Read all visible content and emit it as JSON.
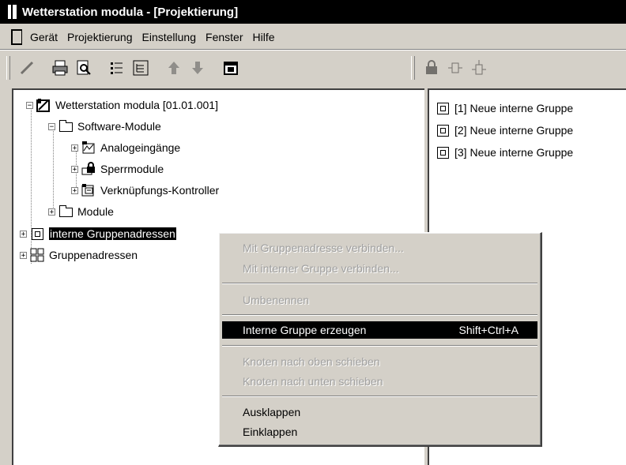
{
  "window": {
    "title": "Wetterstation modula  - [Projektierung]"
  },
  "menu": [
    "Gerät",
    "Projektierung",
    "Einstellung",
    "Fenster",
    "Hilfe"
  ],
  "tree": {
    "root": "Wetterstation modula [01.01.001]",
    "software_modules": "Software-Module",
    "analog_inputs": "Analogeingänge",
    "lock_modules": "Sperrmodule",
    "logic_controller": "Verknüpfungs-Kontroller",
    "modules": "Module",
    "internal_group_addresses": "interne Gruppenadressen",
    "group_addresses": "Gruppenadressen"
  },
  "right_list": [
    "[1] Neue interne Gruppe",
    "[2] Neue interne Gruppe",
    "[3] Neue interne Gruppe"
  ],
  "context_menu": {
    "connect_group_address": "Mit Gruppenadresse verbinden...",
    "connect_internal_group": "Mit interner Gruppe verbinden...",
    "rename": "Umbenennen",
    "create_internal_group": "Interne Gruppe erzeugen",
    "create_shortcut": "Shift+Ctrl+A",
    "move_up": "Knoten nach oben schieben",
    "move_down": "Knoten nach unten schieben",
    "expand": "Ausklappen",
    "collapse": "Einklappen"
  }
}
